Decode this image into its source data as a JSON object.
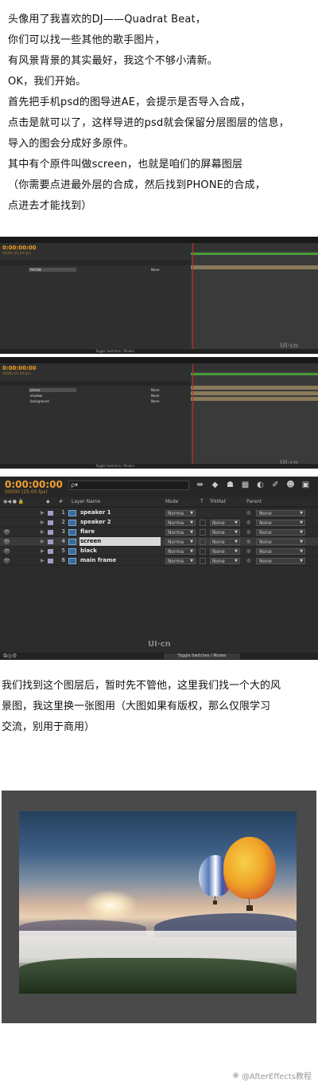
{
  "intro": {
    "lines": [
      "头像用了我喜欢的DJ——Quadrat Beat，",
      "你们可以找一些其他的歌手图片，",
      "有风景背景的其实最好，我这个不够小清新。",
      "OK，我们开始。",
      "首先把手机psd的图导进AE，会提示是否导入合成，",
      "点击是就可以了，这样导进的psd就会保留分层图层的信息，",
      "导入的图会分成好多原件。",
      "其中有个原件叫做screen，也就是咱们的屏幕图层",
      "（你需要点进最外层的合成，然后找到PHONE的合成，",
      "点进去才能找到）"
    ]
  },
  "panel1": {
    "timecode": "0:00:00:00",
    "fps": "00000 (25.00 fps)",
    "layers": [
      {
        "name": "PHONE",
        "parent": "None"
      }
    ],
    "toggle": "Toggle Switches / Modes"
  },
  "panel2": {
    "timecode": "0:00:00:00",
    "fps": "00000 (25.00 fps)",
    "layers": [
      {
        "name": "phone",
        "parent": "None"
      },
      {
        "name": "shadow",
        "parent": "None"
      },
      {
        "name": "background",
        "parent": "None"
      }
    ],
    "toggle": "Toggle Switches / Modes"
  },
  "panel3": {
    "timecode": "0:00:00:00",
    "fps": "00000 (25.00 fps)",
    "search_glyph": "ρ▾",
    "headers": {
      "num": "#",
      "layer_name": "Layer Name",
      "mode": "Mode",
      "t": "T",
      "trkmat": "TrkMat",
      "parent": "Parent"
    },
    "layers": [
      {
        "num": "1",
        "name": "speaker 1",
        "mode": "Norma",
        "trkmat": "",
        "parent": "None",
        "selected": false
      },
      {
        "num": "2",
        "name": "speaker 2",
        "mode": "Norma",
        "trkmat": "None",
        "parent": "None",
        "selected": false
      },
      {
        "num": "3",
        "name": "flare",
        "mode": "Norma",
        "trkmat": "None",
        "parent": "None",
        "selected": false
      },
      {
        "num": "4",
        "name": "screen",
        "mode": "Norma",
        "trkmat": "None",
        "parent": "None",
        "selected": true
      },
      {
        "num": "5",
        "name": "black",
        "mode": "Norma",
        "trkmat": "None",
        "parent": "None",
        "selected": false
      },
      {
        "num": "6",
        "name": "main frame",
        "mode": "Norma",
        "trkmat": "None",
        "parent": "None",
        "selected": false
      }
    ],
    "toggle": "Toggle Switches / Modes",
    "watermark": "UI·cn"
  },
  "outro": {
    "lines": [
      "我们找到这个图层后，暂时先不管他，这里我们找一个大的风",
      "景图，我这里换一张图用（大图如果有版权，那么仅限学习",
      "交流，别用于商用）"
    ]
  },
  "credit": {
    "text": "@AfterEffects教程"
  }
}
